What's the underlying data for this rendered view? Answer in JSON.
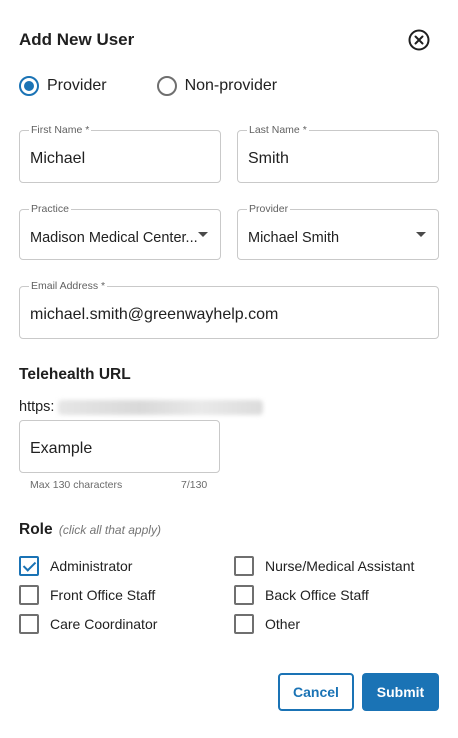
{
  "dialog": {
    "title": "Add New User"
  },
  "user_type": {
    "options": [
      {
        "label": "Provider",
        "selected": true
      },
      {
        "label": "Non-provider",
        "selected": false
      }
    ]
  },
  "fields": {
    "first_name": {
      "label": "First Name *",
      "value": "Michael"
    },
    "last_name": {
      "label": "Last Name *",
      "value": "Smith"
    },
    "practice": {
      "label": "Practice",
      "value": "Madison Medical Center..."
    },
    "provider": {
      "label": "Provider",
      "value": "Michael Smith"
    },
    "email": {
      "label": "Email Address *",
      "value": "michael.smith@greenwayhelp.com"
    }
  },
  "telehealth": {
    "title": "Telehealth URL",
    "prefix": "https:",
    "value": "Example",
    "helper": "Max 130 characters",
    "counter": "7/130"
  },
  "role": {
    "title": "Role",
    "hint": "(click all that apply)",
    "options": [
      {
        "label": "Administrator",
        "checked": true
      },
      {
        "label": "Nurse/Medical Assistant",
        "checked": false
      },
      {
        "label": "Front Office Staff",
        "checked": false
      },
      {
        "label": "Back Office Staff",
        "checked": false
      },
      {
        "label": "Care Coordinator",
        "checked": false
      },
      {
        "label": "Other",
        "checked": false
      }
    ]
  },
  "actions": {
    "cancel_label": "Cancel",
    "submit_label": "Submit"
  },
  "colors": {
    "accent": "#1a73b5",
    "border": "#c9c9c9",
    "text": "#212121"
  }
}
